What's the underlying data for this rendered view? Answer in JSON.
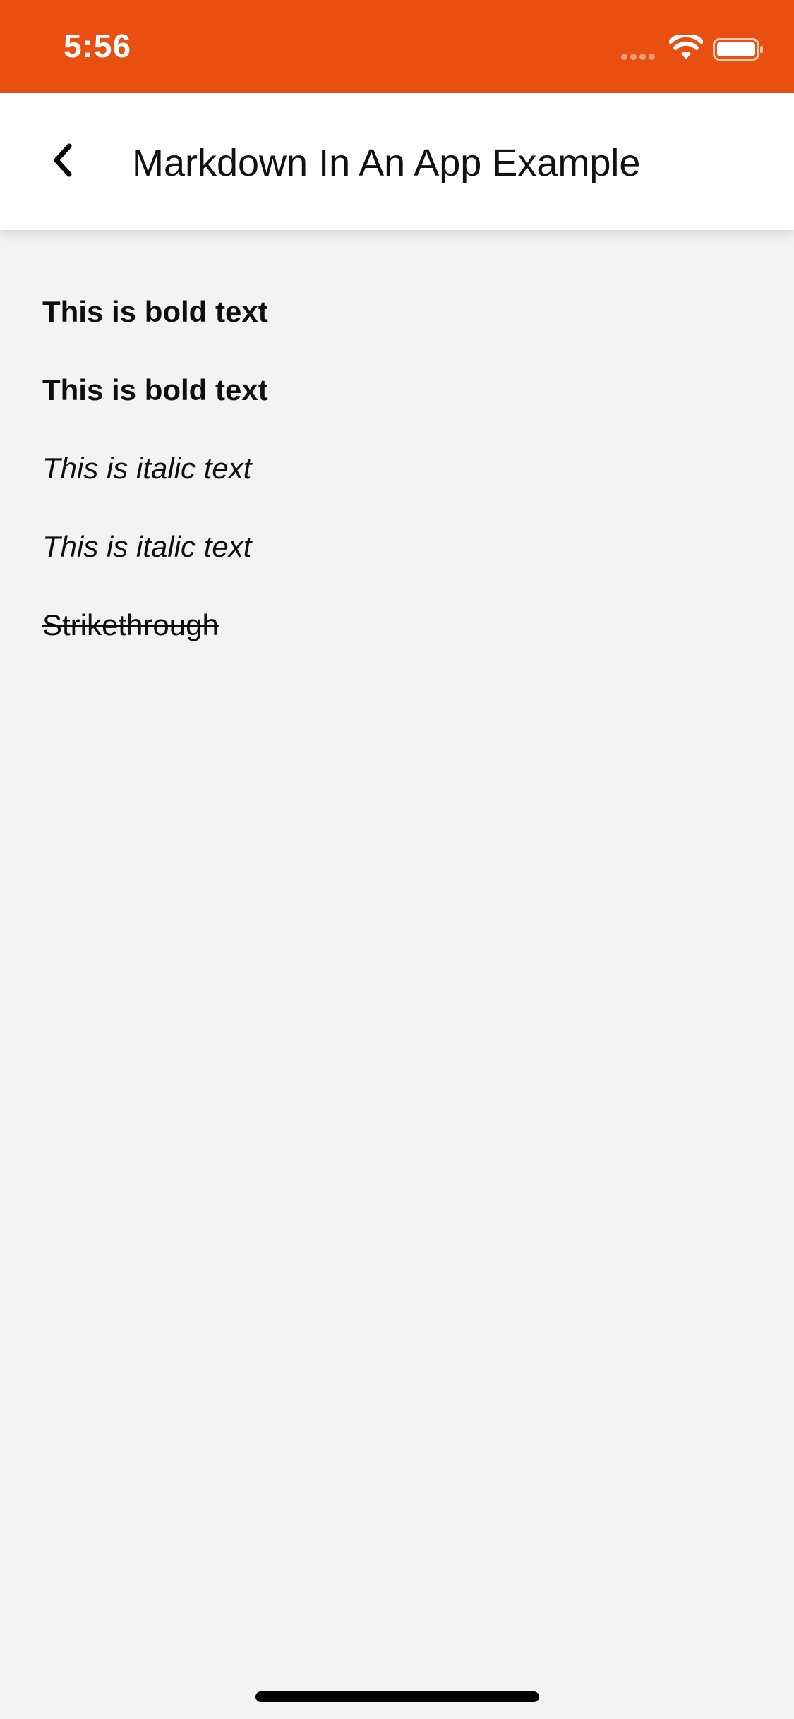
{
  "status_bar": {
    "time": "5:56",
    "background_color": "#e84f11",
    "icons": [
      "signal-dots-icon",
      "wifi-icon",
      "battery-icon"
    ]
  },
  "nav": {
    "back_icon": "chevron-left-icon",
    "title": "Markdown In An App Example"
  },
  "content": {
    "lines": [
      {
        "text": "This is bold text",
        "style": "bold"
      },
      {
        "text": "This is bold text",
        "style": "bold"
      },
      {
        "text": "This is italic text",
        "style": "italic"
      },
      {
        "text": "This is italic text",
        "style": "italic"
      },
      {
        "text": "Strikethrough",
        "style": "strikethrough"
      }
    ]
  }
}
